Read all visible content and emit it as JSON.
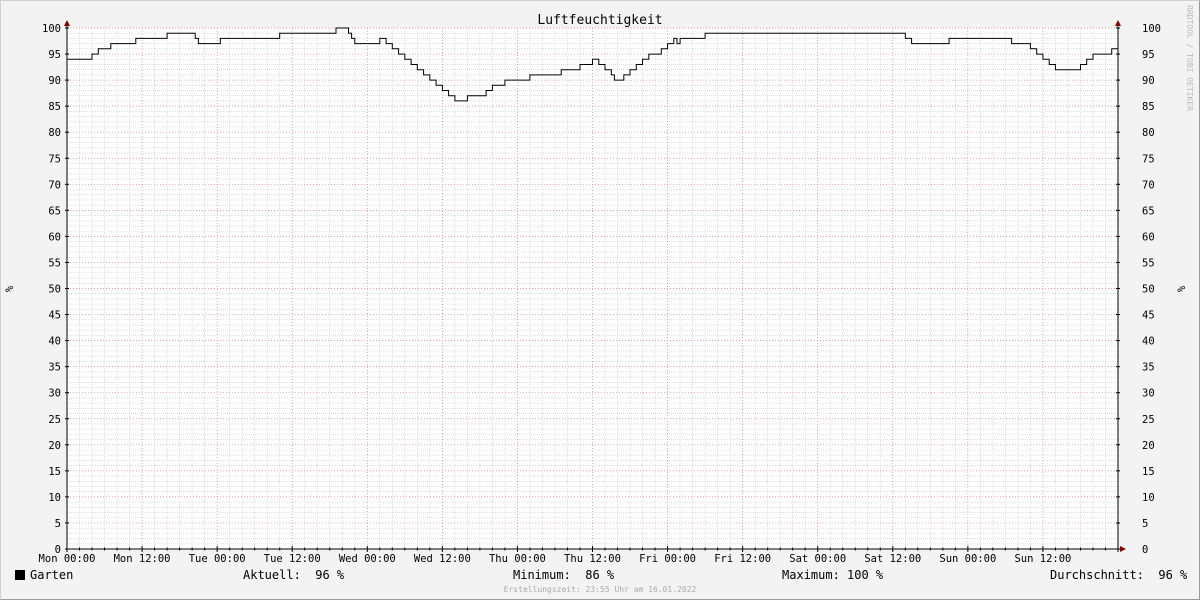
{
  "chart_data": {
    "type": "line",
    "title": "Luftfeuchtigkeit",
    "ylabel": "%",
    "ylabel_right": "%",
    "ylim": [
      0,
      100
    ],
    "y_ticks": [
      0,
      5,
      10,
      15,
      20,
      25,
      30,
      35,
      40,
      45,
      50,
      55,
      60,
      65,
      70,
      75,
      80,
      85,
      90,
      95,
      100
    ],
    "x_ticks": [
      "Mon 00:00",
      "Mon 12:00",
      "Tue 00:00",
      "Tue 12:00",
      "Wed 00:00",
      "Wed 12:00",
      "Thu 00:00",
      "Thu 12:00",
      "Fri 00:00",
      "Fri 12:00",
      "Sat 00:00",
      "Sat 12:00",
      "Sun 00:00",
      "Sun 12:00"
    ],
    "xlim_hours": [
      0,
      168
    ],
    "grid": true,
    "series": [
      {
        "name": "Garten",
        "color": "#000000",
        "x_hours": [
          0,
          2,
          3,
          4,
          4.5,
          5,
          6,
          7,
          9,
          11,
          15,
          16,
          17,
          18,
          20,
          20.5,
          21,
          23,
          24,
          24.5,
          25,
          26,
          28,
          34,
          42,
          43,
          44,
          45,
          45.5,
          46,
          47,
          49,
          50,
          51,
          52,
          53,
          54,
          55,
          56,
          57,
          58,
          59,
          60,
          61,
          62,
          63,
          64,
          65,
          66,
          67,
          68,
          70,
          73,
          74,
          78,
          79,
          80,
          82,
          83,
          84,
          85,
          86,
          87,
          87.5,
          88,
          89,
          90,
          91,
          92,
          93,
          94,
          95,
          96,
          97,
          97.5,
          98,
          98.5,
          99,
          102,
          106,
          112,
          118,
          124,
          133,
          134,
          135,
          140,
          141,
          150,
          151,
          153,
          154,
          155,
          156,
          157,
          158,
          161,
          162,
          163,
          164,
          165,
          167,
          168
        ],
        "values": [
          94,
          94,
          94,
          95,
          95,
          96,
          96,
          97,
          97,
          98,
          98,
          99,
          99,
          99,
          99,
          98,
          97,
          97,
          97,
          98,
          98,
          98,
          98,
          99,
          99,
          100,
          100,
          99,
          98,
          97,
          97,
          97,
          98,
          97,
          96,
          95,
          94,
          93,
          92,
          91,
          90,
          89,
          88,
          87,
          86,
          86,
          87,
          87,
          87,
          88,
          89,
          90,
          90,
          91,
          91,
          92,
          92,
          93,
          93,
          94,
          93,
          92,
          91,
          90,
          90,
          91,
          92,
          93,
          94,
          95,
          95,
          96,
          97,
          98,
          97,
          98,
          98,
          98,
          99,
          99,
          99,
          99,
          99,
          99,
          98,
          97,
          97,
          98,
          98,
          97,
          97,
          96,
          95,
          94,
          93,
          92,
          92,
          93,
          94,
          95,
          95,
          96,
          96,
          96,
          96
        ]
      }
    ]
  },
  "watermark": "RRDTOOL / TOBI OETIKER",
  "legend": {
    "series_label": "Garten",
    "current": "Aktuell:  96 %",
    "minimum": "Minimum:  86 %",
    "maximum": "Maximum: 100 %",
    "average": "Durchschnitt:  96 %"
  },
  "footer": "Erstellungszeit: 23:55 Uhr am 16.01.2022",
  "colors": {
    "background": "#f3f3f3",
    "plot_background": "#ffffff",
    "minor_grid": "#cccccc",
    "major_grid": "#e08080",
    "axis_arrow": "#800000",
    "line": "#000000"
  }
}
